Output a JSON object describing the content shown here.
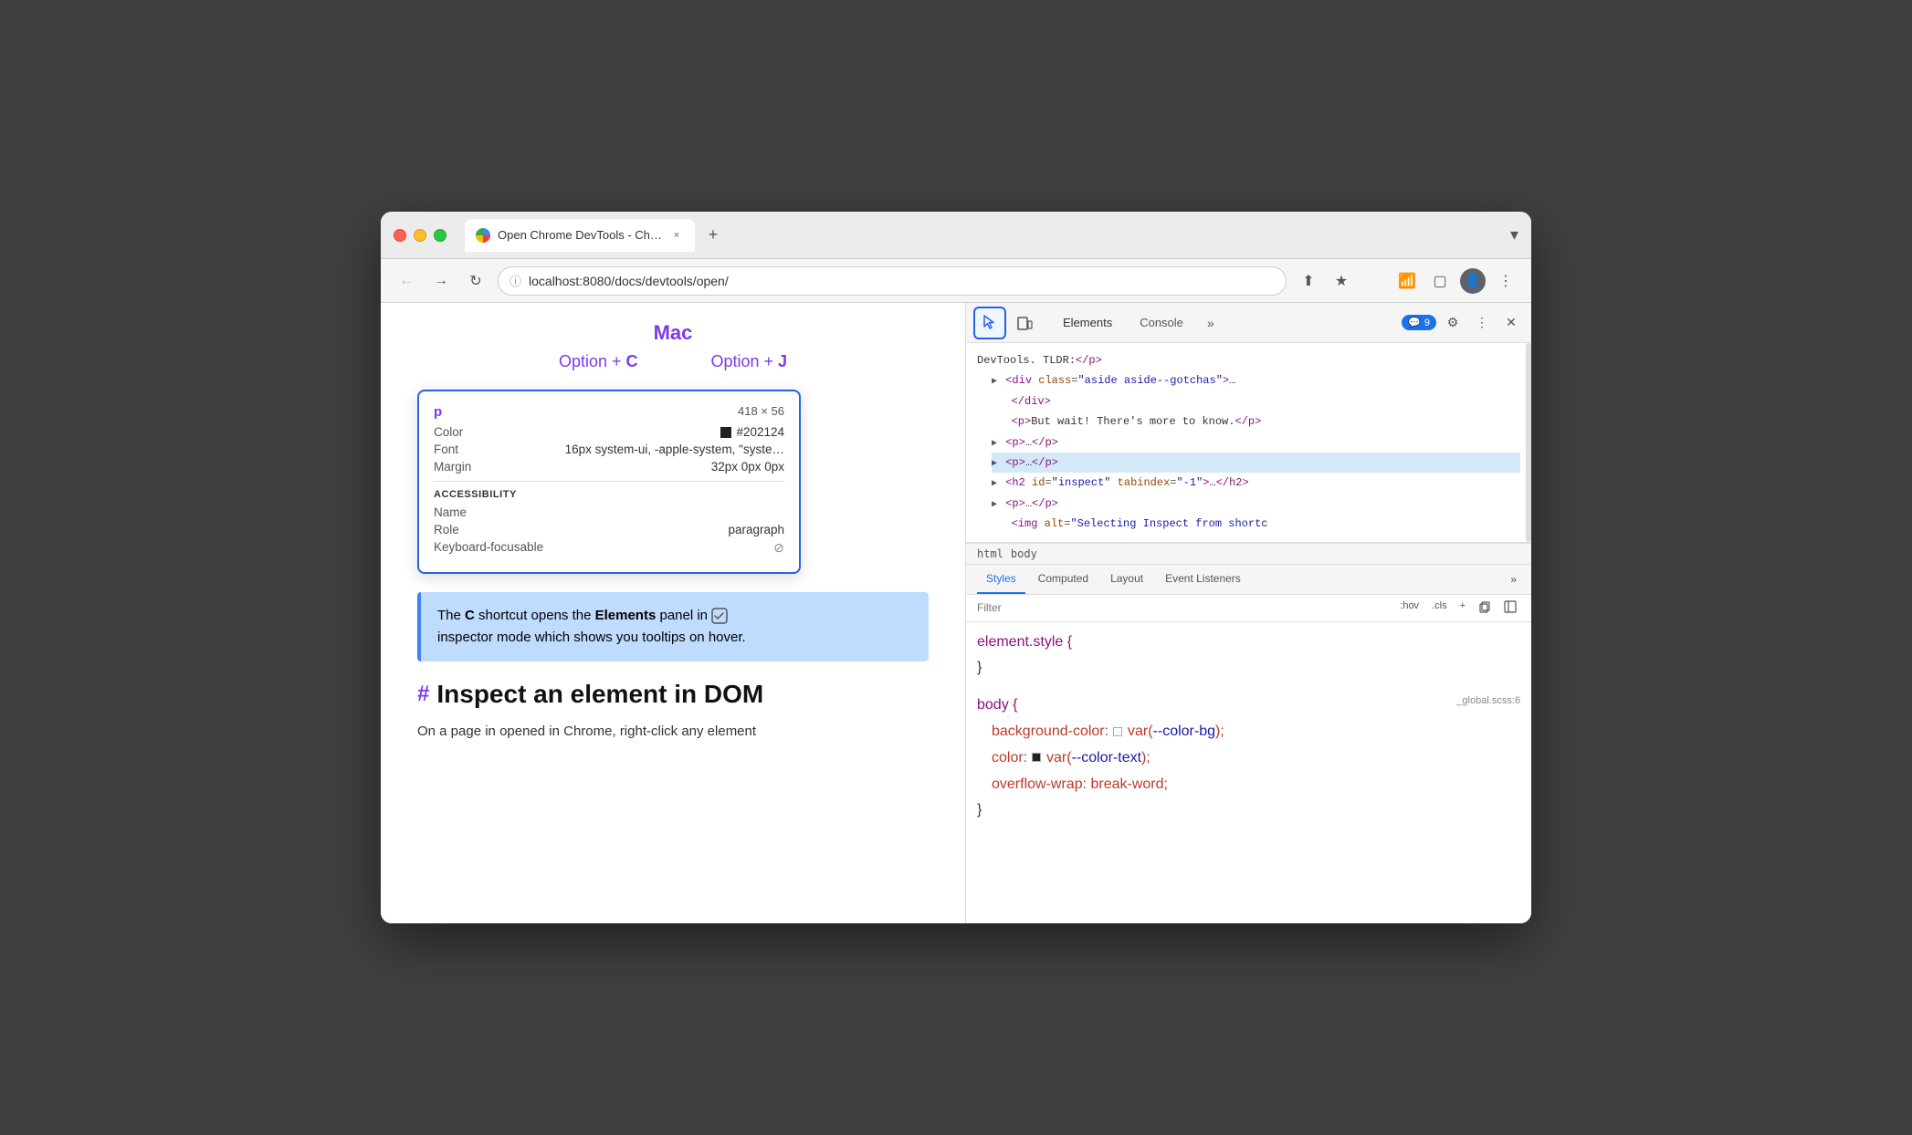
{
  "window": {
    "title": "Open Chrome DevTools - Chrome"
  },
  "titlebar": {
    "tab_label": "Open Chrome DevTools - Chro…",
    "tab_close": "×",
    "new_tab": "+",
    "dropdown": "˅"
  },
  "navbar": {
    "url": "localhost:8080/docs/devtools/open/",
    "back": "←",
    "forward": "→",
    "refresh": "↻"
  },
  "page": {
    "mac_heading": "Mac",
    "shortcut1_label": "Option + ",
    "shortcut1_key": "C",
    "shortcut2_label": "Option + ",
    "shortcut2_key": "J",
    "tooltip": {
      "tag": "p",
      "size": "418 × 56",
      "color_label": "Color",
      "color_value": "#202124",
      "font_label": "Font",
      "font_value": "16px system-ui, -apple-system, \"syste…",
      "margin_label": "Margin",
      "margin_value": "32px 0px 0px",
      "accessibility_title": "ACCESSIBILITY",
      "name_label": "Name",
      "role_label": "Role",
      "role_value": "paragraph",
      "keyboard_label": "Keyboard-focusable"
    },
    "highlight_text1": "The ",
    "highlight_bold1": "C",
    "highlight_text2": " shortcut opens the ",
    "highlight_bold2": "Elements",
    "highlight_text3": " panel in ",
    "highlight_text4": "inspector mode which shows you tooltips on hover.",
    "section_heading": "Inspect an element in DOM",
    "section_hash": "#",
    "body_text": "On a page in opened in Chrome, right-click any element"
  },
  "devtools": {
    "inspector_tooltip": "Select an element in the page to inspect it",
    "device_tooltip": "Toggle device toolbar",
    "tabs": [
      {
        "label": "Elements",
        "active": true
      },
      {
        "label": "Console",
        "active": false
      }
    ],
    "console_badge": "9",
    "more_tabs": "»",
    "settings_icon": "⚙",
    "more_options": "⋮",
    "close": "×",
    "dom_tree": [
      {
        "text": "DevTools. TLDR:</p>",
        "indent": 0,
        "highlighted": false
      },
      {
        "text": "▶ <div class=\"aside aside--gotchas\">…",
        "indent": 1,
        "highlighted": false
      },
      {
        "text": "   </div>",
        "indent": 1,
        "highlighted": false
      },
      {
        "text": "   <p>But wait! There's more to know.</p>",
        "indent": 1,
        "highlighted": false
      },
      {
        "text": "▶ <p>…</p>",
        "indent": 1,
        "highlighted": false
      },
      {
        "text": "▶ <p>…</p>",
        "indent": 1,
        "highlighted": true
      },
      {
        "text": "▶ <h2 id=\"inspect\" tabindex=\"-1\">…</h2>",
        "indent": 1,
        "highlighted": false
      },
      {
        "text": "▶ <p>…</p>",
        "indent": 1,
        "highlighted": false
      },
      {
        "text": "   <img alt=\"Selecting Inspect from shortc",
        "indent": 1,
        "highlighted": false
      }
    ],
    "breadcrumbs": [
      "html",
      "body"
    ],
    "style_tabs": [
      {
        "label": "Styles",
        "active": true
      },
      {
        "label": "Computed",
        "active": false
      },
      {
        "label": "Layout",
        "active": false
      },
      {
        "label": "Event Listeners",
        "active": false
      }
    ],
    "filter_placeholder": "Filter",
    "filter_hov": ":hov",
    "filter_cls": ".cls",
    "filter_plus": "+",
    "styles": [
      {
        "selector": "element.style {",
        "close": "}",
        "properties": []
      },
      {
        "selector": "body {",
        "close": "}",
        "source": "_global.scss:6",
        "properties": [
          {
            "prop": "background-color:",
            "value": "var(--color-bg);",
            "type": "var",
            "has_swatch": true,
            "swatch_color": "#fff"
          },
          {
            "prop": "color:",
            "value": "var(--color-text);",
            "type": "var",
            "has_swatch": true,
            "swatch_color": "#202124"
          },
          {
            "prop": "overflow-wrap:",
            "value": "break-word;",
            "type": "plain"
          }
        ]
      }
    ]
  }
}
